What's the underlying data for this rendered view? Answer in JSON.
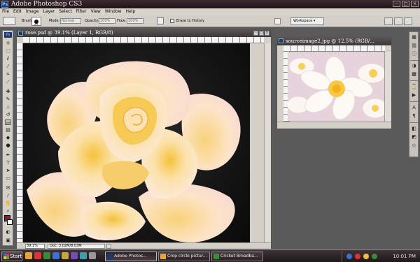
{
  "app": {
    "title": "Adobe Photoshop CS3"
  },
  "menu": [
    "File",
    "Edit",
    "Image",
    "Layer",
    "Select",
    "Filter",
    "View",
    "Window",
    "Help"
  ],
  "options": {
    "brush_label": "Brush:",
    "brush_size": "25",
    "mode_label": "Mode:",
    "mode_value": "Normal",
    "opacity_label": "Opacity:",
    "opacity_value": "100%",
    "flow_label": "Flow:",
    "flow_value": "100%",
    "erase_history": "Erase to History",
    "workspace": "Workspace ▾"
  },
  "toolbox": {
    "ps_label": "Ps"
  },
  "document": {
    "title": "rose.psd @ 39.1% (Layer 1, RGB/8)",
    "zoom": "39.1%",
    "doc_info": "Doc: 3.02M/8.03M"
  },
  "source": {
    "title": "sourceimage2.jpg @ 12.5% (RGB/..."
  },
  "taskbar": {
    "start": "Start",
    "tasks": [
      "Adobe Photos...",
      "Crop circle pictur...",
      "Cricket Broadba..."
    ],
    "clock": "10:01 PM"
  },
  "colors": {
    "foreground": "#8a1a3a",
    "background": "#ffffff",
    "accent": "#3c2c30"
  },
  "icons": [
    "move-icon",
    "marquee-icon",
    "lasso-icon",
    "magic-wand-icon",
    "crop-icon",
    "slice-icon",
    "healing-icon",
    "brush-icon",
    "stamp-icon",
    "history-brush-icon",
    "eraser-icon",
    "gradient-icon",
    "blur-icon",
    "dodge-icon",
    "pen-icon",
    "type-icon",
    "path-select-icon",
    "shape-icon",
    "notes-icon",
    "eyedropper-icon",
    "hand-icon",
    "zoom-icon"
  ]
}
